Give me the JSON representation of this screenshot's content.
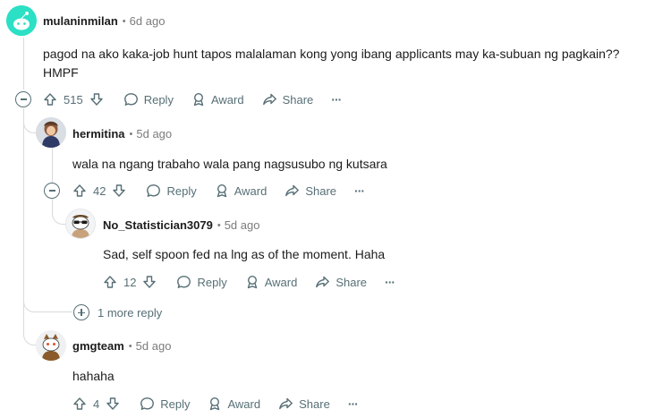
{
  "comments": [
    {
      "author": "mulaninmilan",
      "time": "6d ago",
      "body": "pagod na ako kaka-job hunt tapos malalaman kong yong ibang applicants may ka-subuan ng pagkain?? HMPF",
      "votes": "515",
      "reply_label": "Reply",
      "award_label": "Award",
      "share_label": "Share",
      "more_label": "···"
    },
    {
      "author": "hermitina",
      "time": "5d ago",
      "body": "wala na ngang trabaho wala pang nagsusubo ng kutsara",
      "votes": "42",
      "reply_label": "Reply",
      "award_label": "Award",
      "share_label": "Share",
      "more_label": "···"
    },
    {
      "author": "No_Statistician3079",
      "time": "5d ago",
      "body": "Sad, self spoon fed na lng as of the moment. Haha",
      "votes": "12",
      "reply_label": "Reply",
      "award_label": "Award",
      "share_label": "Share",
      "more_label": "···"
    },
    {
      "author": "gmgteam",
      "time": "5d ago",
      "body": "hahaha",
      "votes": "4",
      "reply_label": "Reply",
      "award_label": "Award",
      "share_label": "Share",
      "more_label": "···"
    }
  ],
  "more_replies_label": "1 more reply",
  "dot_separator": "•",
  "icons": [
    "upvote-icon",
    "downvote-icon",
    "reply-bubble-icon",
    "award-icon",
    "share-arrow-icon",
    "collapse-icon",
    "expand-icon"
  ],
  "colors": {
    "meta_gray": "#7c7c7c",
    "action_gray": "#576f76",
    "thread_line": "#d7dadc",
    "text": "#1c1c1c",
    "op_avatar": "#2be0c4"
  }
}
